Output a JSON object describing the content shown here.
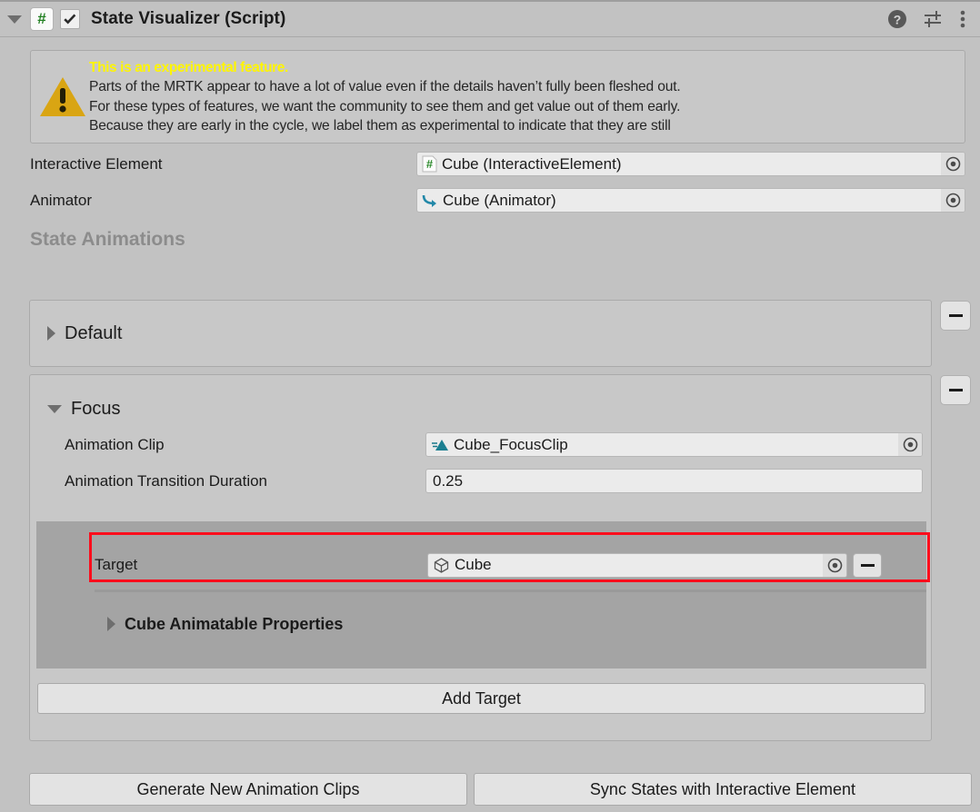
{
  "component": {
    "title": "State Visualizer (Script)",
    "script_icon": "script-hash-icon",
    "enabled_checkbox": true,
    "foldout_expanded": true,
    "help_icon": "help-icon",
    "preset_icon": "preset-sliders-icon",
    "menu_icon": "vertical-ellipsis-icon"
  },
  "helpbox": {
    "icon": "warning-triangle-icon",
    "title": "This is an experimental feature.",
    "lines": [
      "Parts of the MRTK appear to have a lot of value even if the details haven’t fully been fleshed out.",
      "For these types of features, we want the community to see them and get value out of them early.",
      "Because they are early in the cycle, we label them as experimental to indicate that they are still"
    ]
  },
  "properties": [
    {
      "label": "Interactive Element",
      "value": "Cube (InteractiveElement)",
      "icon": "script-hash-icon",
      "picker": "object-picker-icon"
    },
    {
      "label": "Animator",
      "value": "Cube (Animator)",
      "icon": "animator-icon",
      "picker": "object-picker-icon"
    }
  ],
  "state_animations": {
    "header": "State Animations",
    "states": [
      {
        "name": "Default",
        "expanded": false,
        "remove_label": "–"
      },
      {
        "name": "Focus",
        "expanded": true,
        "remove_label": "–",
        "animation_clip": {
          "label": "Animation Clip",
          "value": "Cube_FocusClip",
          "icon": "animation-clip-icon",
          "picker": "object-picker-icon"
        },
        "transition_duration": {
          "label": "Animation Transition Duration",
          "value": "0.25"
        },
        "target": {
          "label": "Target",
          "value": "Cube",
          "icon": "gameobject-cube-icon",
          "picker": "object-picker-icon",
          "remove_label": "–",
          "highlighted": true,
          "highlight_color": "#fc0d1c"
        },
        "animatable_properties": {
          "label": "Cube Animatable Properties",
          "expanded": false
        },
        "add_target_button": "Add Target"
      }
    ]
  },
  "footer": {
    "generate_button": "Generate New Animation Clips",
    "sync_button": "Sync States with Interactive Element"
  }
}
